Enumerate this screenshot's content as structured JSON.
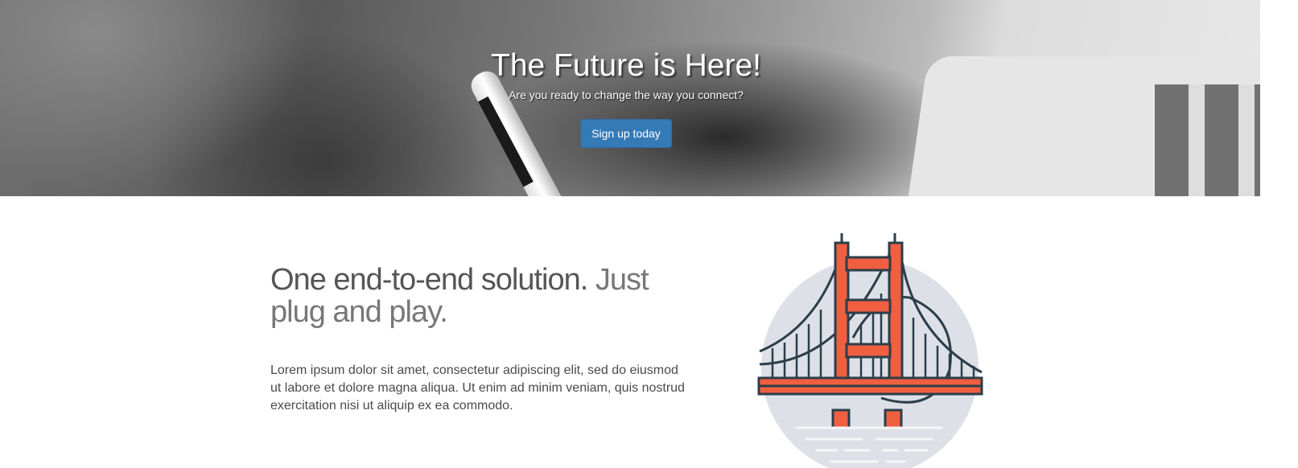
{
  "hero": {
    "title": "The Future is Here!",
    "subtitle": "Are you ready to change the way you connect?",
    "cta_label": "Sign up today"
  },
  "feature": {
    "heading_main": "One end-to-end solution.",
    "heading_muted": "Just plug and play.",
    "body": "Lorem ipsum dolor sit amet, consectetur adipiscing elit, sed do eiusmod ut labore et dolore magna aliqua. Ut enim ad minim veniam, quis nostrud exercitation nisi ut aliquip ex ea commodo.",
    "illustration": "golden-gate-bridge-icon"
  },
  "colors": {
    "accent": "#337ab7",
    "bridge": "#f05f40",
    "outline": "#2c3e4a",
    "circle": "#dde1e7"
  }
}
